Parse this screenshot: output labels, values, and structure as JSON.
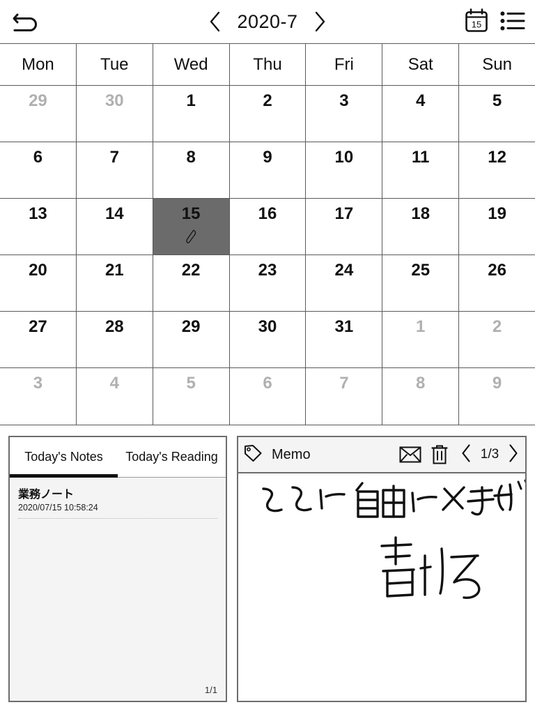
{
  "topbar": {
    "back_icon": "back-arrow-icon",
    "prev_icon": "chevron-left-icon",
    "next_icon": "chevron-right-icon",
    "month_title": "2020-7",
    "calendar_icon": "calendar-15-icon",
    "calendar_icon_day": "15",
    "list_icon": "list-icon"
  },
  "calendar": {
    "weekdays": [
      "Mon",
      "Tue",
      "Wed",
      "Thu",
      "Fri",
      "Sat",
      "Sun"
    ],
    "selected_day": 15,
    "selected_marker_icon": "pen-icon",
    "weeks": [
      [
        {
          "n": "29",
          "out": true
        },
        {
          "n": "30",
          "out": true
        },
        {
          "n": "1",
          "out": false
        },
        {
          "n": "2",
          "out": false
        },
        {
          "n": "3",
          "out": false
        },
        {
          "n": "4",
          "out": false
        },
        {
          "n": "5",
          "out": false
        }
      ],
      [
        {
          "n": "6",
          "out": false
        },
        {
          "n": "7",
          "out": false
        },
        {
          "n": "8",
          "out": false
        },
        {
          "n": "9",
          "out": false
        },
        {
          "n": "10",
          "out": false
        },
        {
          "n": "11",
          "out": false
        },
        {
          "n": "12",
          "out": false
        }
      ],
      [
        {
          "n": "13",
          "out": false
        },
        {
          "n": "14",
          "out": false
        },
        {
          "n": "15",
          "out": false,
          "selected": true
        },
        {
          "n": "16",
          "out": false
        },
        {
          "n": "17",
          "out": false
        },
        {
          "n": "18",
          "out": false
        },
        {
          "n": "19",
          "out": false
        }
      ],
      [
        {
          "n": "20",
          "out": false
        },
        {
          "n": "21",
          "out": false
        },
        {
          "n": "22",
          "out": false
        },
        {
          "n": "23",
          "out": false
        },
        {
          "n": "24",
          "out": false
        },
        {
          "n": "25",
          "out": false
        },
        {
          "n": "26",
          "out": false
        }
      ],
      [
        {
          "n": "27",
          "out": false
        },
        {
          "n": "28",
          "out": false
        },
        {
          "n": "29",
          "out": false
        },
        {
          "n": "30",
          "out": false
        },
        {
          "n": "31",
          "out": false
        },
        {
          "n": "1",
          "out": true
        },
        {
          "n": "2",
          "out": true
        }
      ],
      [
        {
          "n": "3",
          "out": true
        },
        {
          "n": "4",
          "out": true
        },
        {
          "n": "5",
          "out": true
        },
        {
          "n": "6",
          "out": true
        },
        {
          "n": "7",
          "out": true
        },
        {
          "n": "8",
          "out": true
        },
        {
          "n": "9",
          "out": true
        }
      ]
    ]
  },
  "notes_panel": {
    "tabs": [
      {
        "label": "Today's Notes",
        "active": true
      },
      {
        "label": "Today's Reading",
        "active": false
      }
    ],
    "entries": [
      {
        "title": "業務ノート",
        "time": "2020/07/15 10:58:24"
      }
    ],
    "page_indicator": "1/1"
  },
  "memo_panel": {
    "tag_icon": "tag-icon",
    "label": "Memo",
    "mail_icon": "envelope-icon",
    "delete_icon": "trash-icon",
    "prev_icon": "chevron-left-icon",
    "next_icon": "chevron-right-icon",
    "page_indicator": "1/3",
    "handwriting_text": "ここに自由にメモが書ける"
  },
  "colors": {
    "selected_cell": "#6b6b6b",
    "grid_line": "#5a5a5a",
    "panel_border": "#6d6d6d",
    "panel_fill": "#f4f4f4",
    "out_of_month_text": "#b0b0b0",
    "ink": "#111111"
  }
}
